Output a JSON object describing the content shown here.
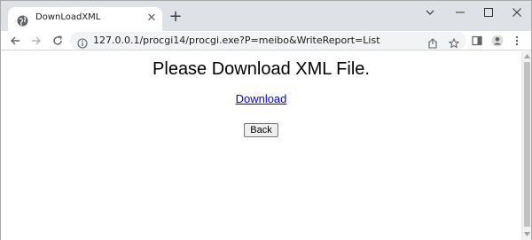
{
  "tab": {
    "title": "DownLoadXML",
    "favicon": "globe-icon"
  },
  "window_controls": {
    "dropdown": "chevron-down-icon",
    "minimize": "minimize-icon",
    "maximize": "maximize-icon",
    "close": "close-icon"
  },
  "address_bar": {
    "url": "127.0.0.1/procgi14/procgi.exe?P=meibo&WriteReport=List"
  },
  "page": {
    "heading": "Please Download XML File.",
    "link_label": "Download",
    "back_label": "Back"
  },
  "colors": {
    "link": "#0000ee",
    "tabstrip": "#dee1e6",
    "omnibox": "#f1f3f4"
  }
}
